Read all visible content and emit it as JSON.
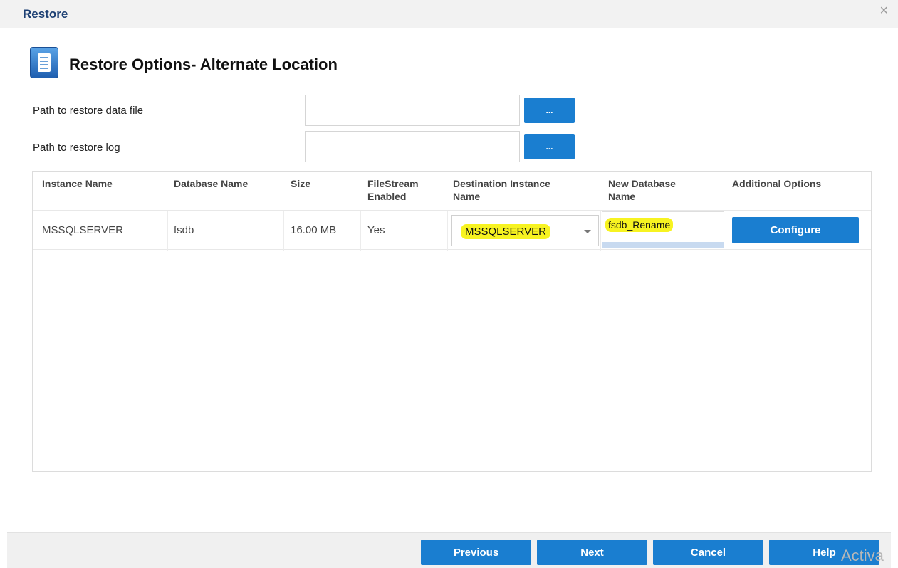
{
  "window": {
    "title": "Restore",
    "close_glyph": "×"
  },
  "heading": {
    "text": "Restore Options- Alternate Location",
    "icon": "document-icon"
  },
  "paths": {
    "data_file": {
      "label": "Path to restore data file",
      "value": "",
      "browse_label": "..."
    },
    "log": {
      "label": "Path to restore log",
      "value": "",
      "browse_label": "..."
    }
  },
  "table": {
    "columns": [
      {
        "line1": "Instance Name",
        "line2": ""
      },
      {
        "line1": "Database Name",
        "line2": ""
      },
      {
        "line1": "Size",
        "line2": ""
      },
      {
        "line1": "FileStream",
        "line2": "Enabled"
      },
      {
        "line1": "Destination Instance",
        "line2": "Name"
      },
      {
        "line1": "New Database",
        "line2": "Name"
      },
      {
        "line1": "Additional Options",
        "line2": ""
      }
    ],
    "rows": [
      {
        "instance": "MSSQLSERVER",
        "database": "fsdb",
        "size": "16.00 MB",
        "filestream": "Yes",
        "destination_instance": "MSSQLSERVER",
        "new_database_name": "fsdb_Rename",
        "action_label": "Configure"
      }
    ]
  },
  "footer": {
    "previous": "Previous",
    "next": "Next",
    "cancel": "Cancel",
    "help": "Help",
    "watermark": "Activa"
  },
  "colors": {
    "accent": "#1a7ed0",
    "title": "#1c3f73",
    "highlight": "#f7f321"
  }
}
